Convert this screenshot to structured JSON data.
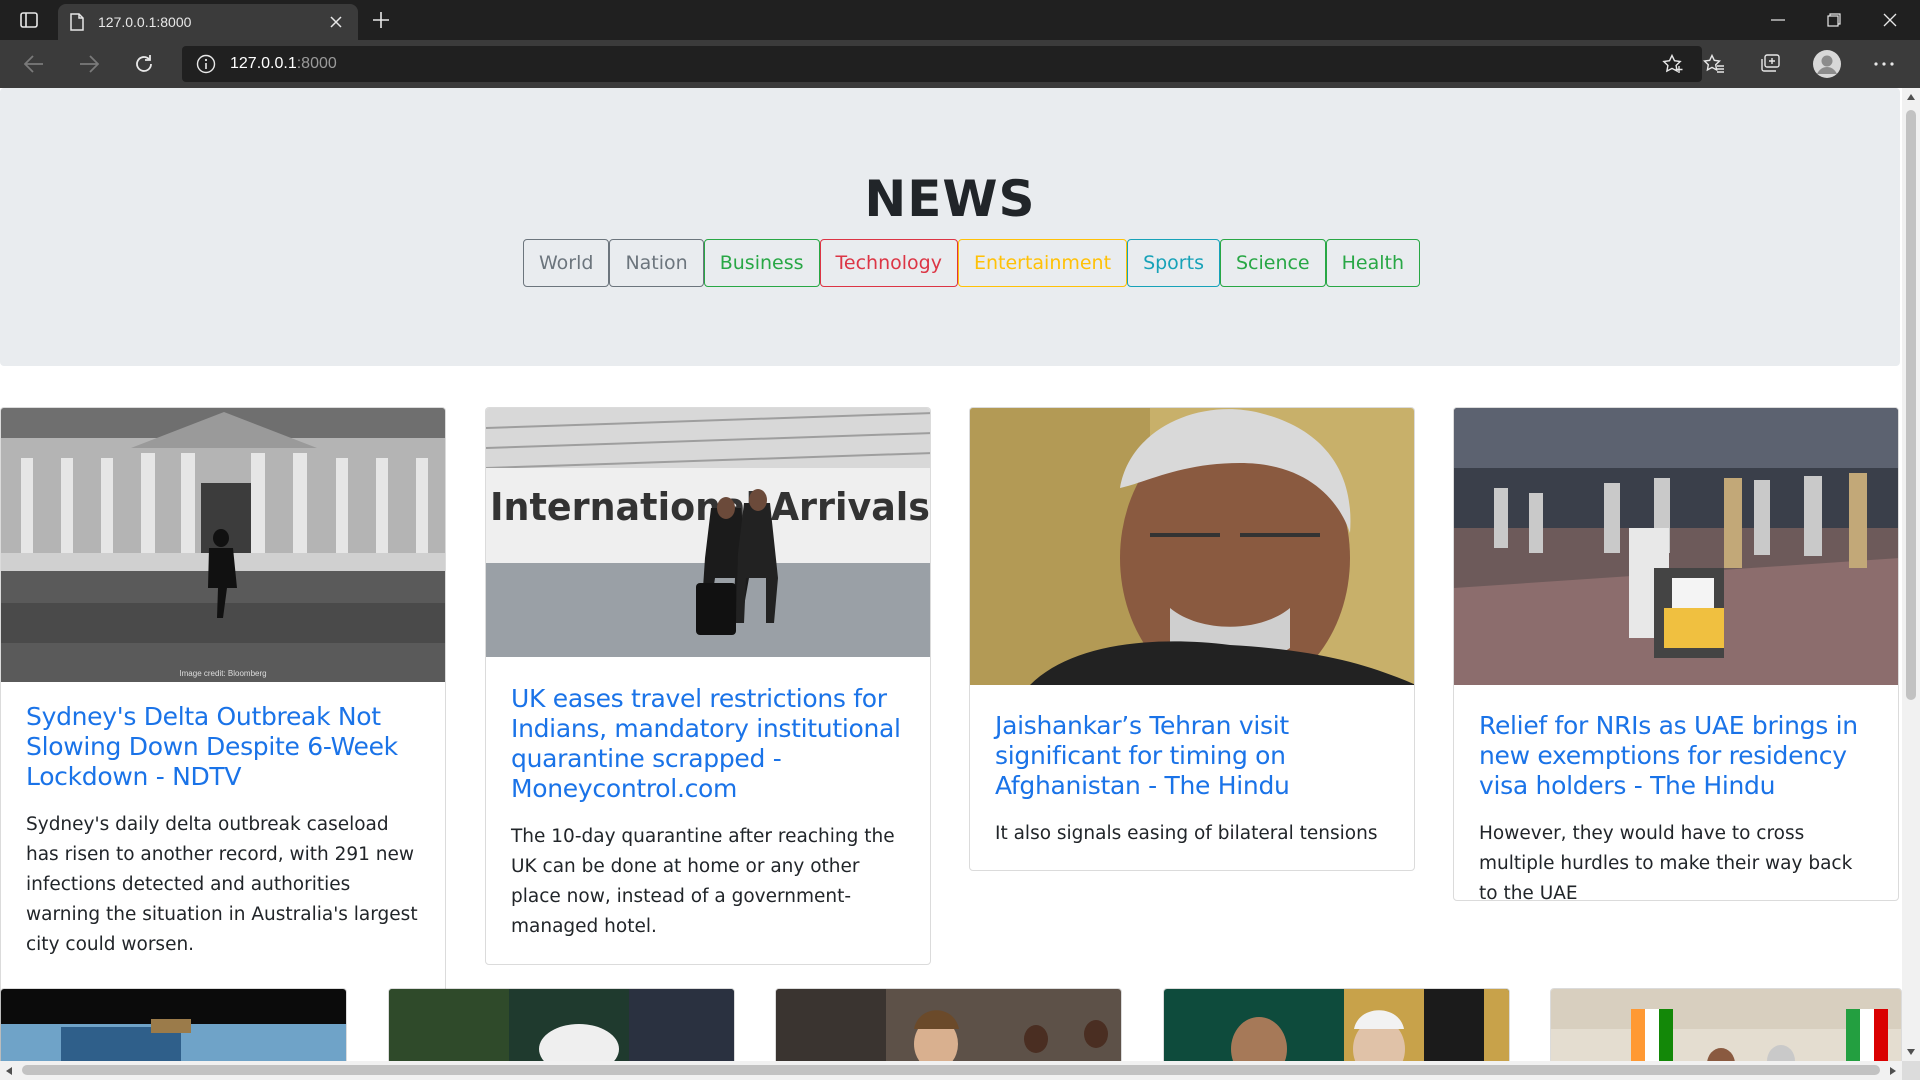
{
  "browser": {
    "tab_title": "127.0.0.1:8000",
    "url_host": "127.0.0.1",
    "url_port": ":8000"
  },
  "page": {
    "brand": "NEWS",
    "categories": [
      {
        "label": "World",
        "color": "#6c757d"
      },
      {
        "label": "Nation",
        "color": "#6c757d"
      },
      {
        "label": "Business",
        "color": "#28a745"
      },
      {
        "label": "Technology",
        "color": "#dc3545"
      },
      {
        "label": "Entertainment",
        "color": "#ffc107"
      },
      {
        "label": "Sports",
        "color": "#17a2b8"
      },
      {
        "label": "Science",
        "color": "#28a745"
      },
      {
        "label": "Health",
        "color": "#28a745"
      }
    ],
    "articles": [
      {
        "title": "Sydney's Delta Outbreak Not Slowing Down Despite 6-Week Lockdown - NDTV",
        "description": "Sydney's daily delta outbreak caseload has risen to another record, with 291 new infections detected and authorities warning the situation in Australia's largest city could worsen.",
        "image_credit": "Image credit: Bloomberg"
      },
      {
        "title": "UK eases travel restrictions for Indians, mandatory institutional quarantine scrapped - Moneycontrol.com",
        "description": "The 10-day quarantine after reaching the UK can be done at home or any other place now, instead of a government-managed hotel.",
        "image_sign": "International Arrivals"
      },
      {
        "title": "Jaishankar’s Tehran visit significant for timing on Afghanistan - The Hindu",
        "description": "It also signals easing of bilateral tensions"
      },
      {
        "title": "Relief for NRIs as UAE brings in new exemptions for residency visa holders - The Hindu",
        "description": "However, they would have to cross multiple hurdles to make their way back to the UAE"
      }
    ]
  }
}
